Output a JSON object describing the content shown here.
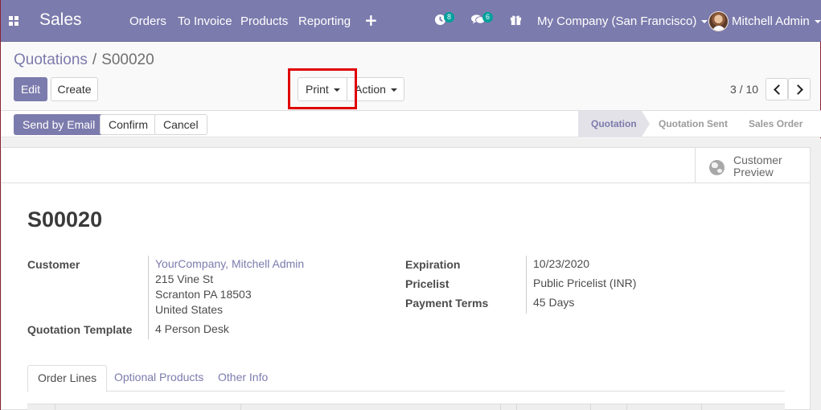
{
  "navbar": {
    "app_name": "Sales",
    "menu": [
      "Orders",
      "To Invoice",
      "Products",
      "Reporting"
    ],
    "plus_symbol": "+",
    "activity_count": "8",
    "message_count": "6",
    "company": "My Company (San Francisco)",
    "user": "Mitchell Admin",
    "icons": [
      "apps-menu-icon",
      "activity-clock-icon",
      "chat-icon",
      "gift-icon"
    ]
  },
  "breadcrumb": {
    "parent": "Quotations",
    "separator": "/",
    "current": "S00020"
  },
  "toolbar": {
    "edit_label": "Edit",
    "create_label": "Create",
    "print_label": "Print",
    "action_label": "Action"
  },
  "pager": {
    "value": "3 / 10"
  },
  "statusbar": {
    "send_email_label": "Send by Email",
    "confirm_label": "Confirm",
    "cancel_label": "Cancel",
    "stages": [
      "Quotation",
      "Quotation Sent",
      "Sales Order"
    ],
    "active_stage": "Quotation"
  },
  "sheet": {
    "preview_label": "Customer Preview",
    "title": "S00020",
    "fields": {
      "customer_label": "Customer",
      "customer_name": "YourCompany, Mitchell Admin",
      "customer_address": [
        "215 Vine St",
        "Scranton PA 18503",
        "United States"
      ],
      "template_label": "Quotation Template",
      "template_value": "4 Person Desk",
      "expiration_label": "Expiration",
      "expiration_value": "10/23/2020",
      "pricelist_label": "Pricelist",
      "pricelist_value": "Public Pricelist (INR)",
      "payment_terms_label": "Payment Terms",
      "payment_terms_value": "45 Days"
    },
    "tabs": [
      "Order Lines",
      "Optional Products",
      "Other Info"
    ],
    "active_tab": "Order Lines"
  },
  "colors": {
    "brand": "#7c7bad",
    "badge": "#00a09d",
    "highlight": "#e00000"
  }
}
